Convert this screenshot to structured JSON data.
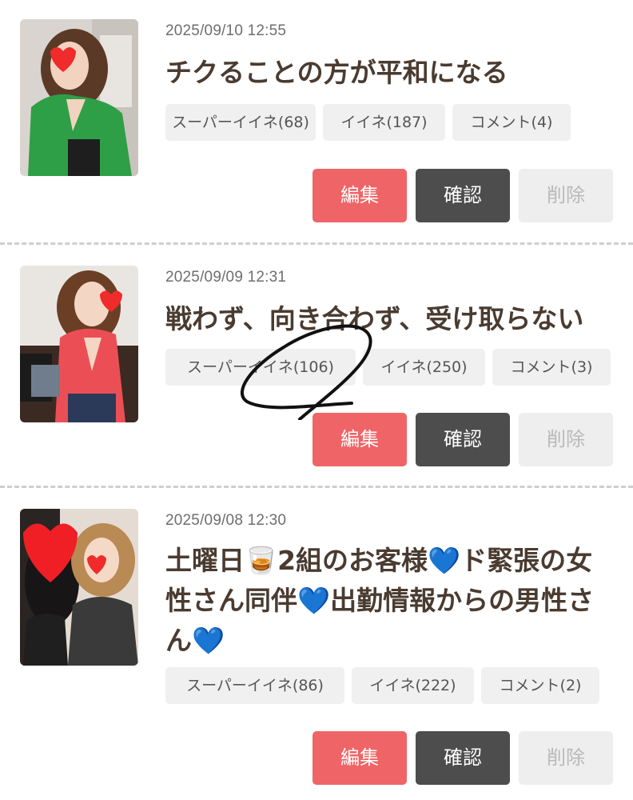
{
  "posts": [
    {
      "timestamp": "2025/09/10 12:55",
      "title": "チクることの方が平和になる",
      "super_like": "スーパーイイネ(68)",
      "like": "イイネ(187)",
      "comment": "コメント(4)",
      "edit": "編集",
      "confirm": "確認",
      "delete": "削除"
    },
    {
      "timestamp": "2025/09/09 12:31",
      "title": "戦わず、向き合わず、受け取らない",
      "super_like": "スーパーイイネ(106)",
      "like": "イイネ(250)",
      "comment": "コメント(3)",
      "edit": "編集",
      "confirm": "確認",
      "delete": "削除"
    },
    {
      "timestamp": "2025/09/08 12:30",
      "title_line1": "土曜日🥃2組のお客様💙ド緊張の女",
      "title_line2": "性さん同伴💙出勤情報からの男性さ",
      "title_line3": "ん💙",
      "super_like": "スーパーイイネ(86)",
      "like": "イイネ(222)",
      "comment": "コメント(2)",
      "edit": "編集",
      "confirm": "確認",
      "delete": "削除"
    }
  ],
  "colors": {
    "edit": "#ef6567",
    "confirm": "#4d4d4d",
    "delete_bg": "#eeeeee",
    "chip_bg": "#f0f0f0",
    "title_text": "#4a3b30"
  }
}
